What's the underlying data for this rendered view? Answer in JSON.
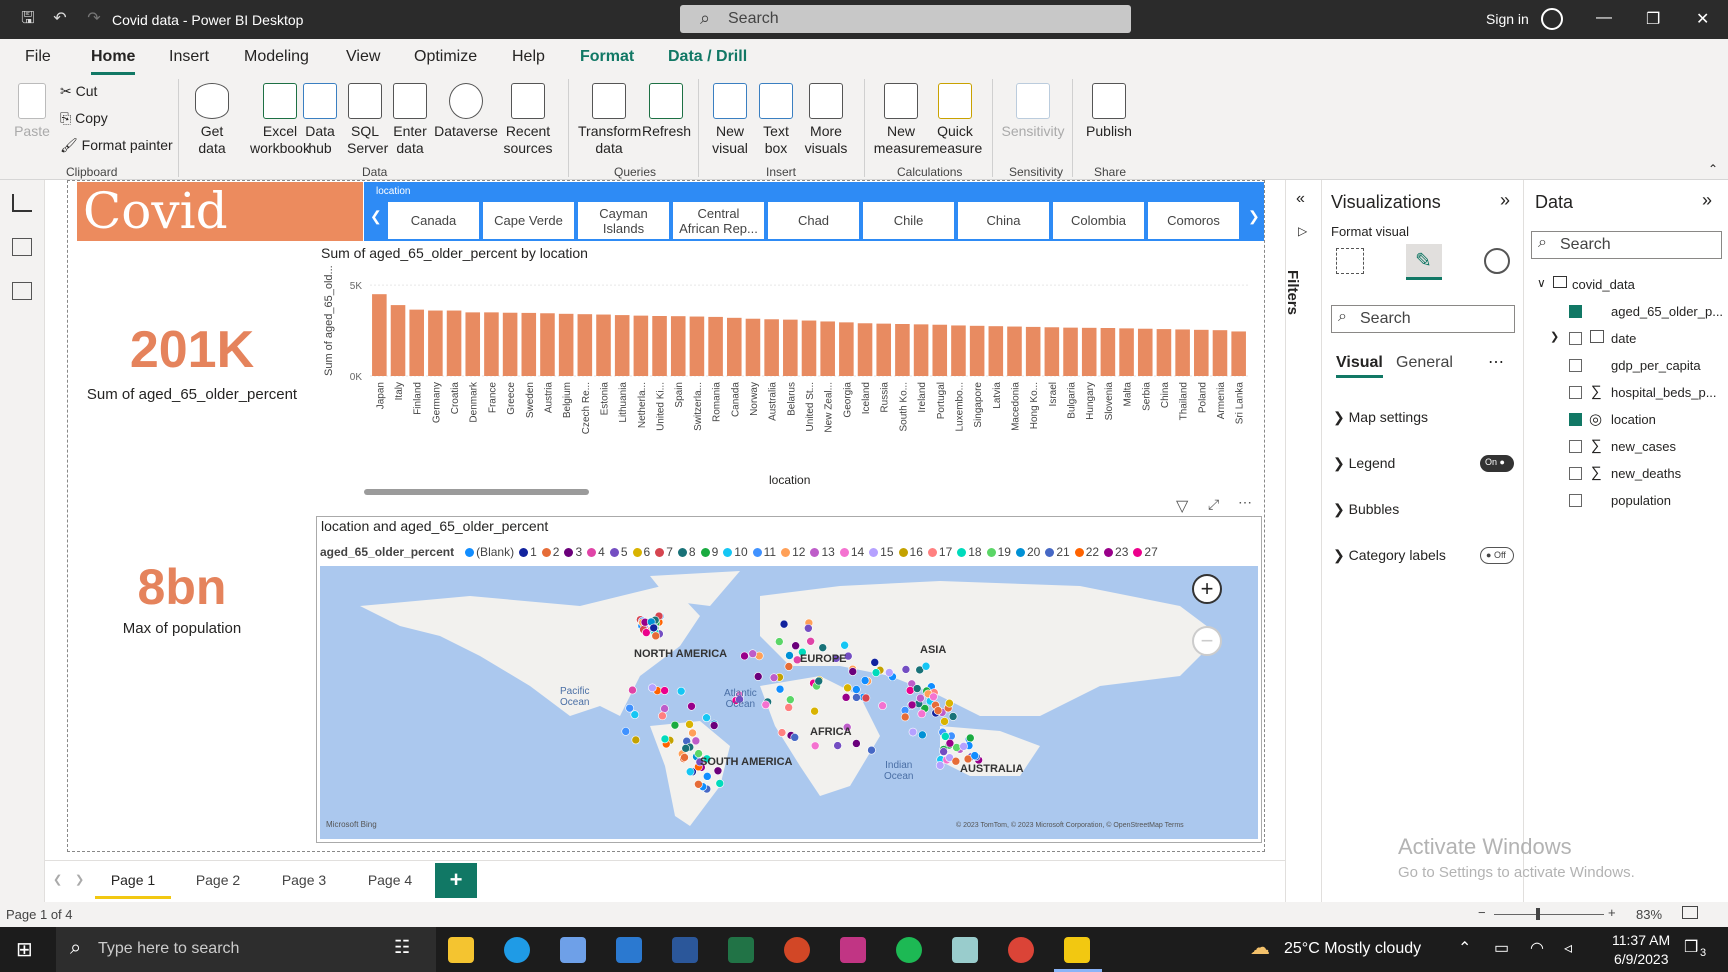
{
  "window": {
    "title": "Covid data - Power BI Desktop",
    "search_placeholder": "Search",
    "signin": "Sign in"
  },
  "menu": {
    "items": [
      "File",
      "Home",
      "Insert",
      "Modeling",
      "View",
      "Optimize",
      "Help",
      "Format",
      "Data / Drill"
    ]
  },
  "ribbon": {
    "clipboard": {
      "paste": "Paste",
      "cut": "Cut",
      "copy": "Copy",
      "format_painter": "Format painter",
      "group": "Clipboard"
    },
    "data": {
      "get_data": "Get\ndata",
      "excel": "Excel\nworkbook",
      "data_hub": "Data\nhub",
      "sql": "SQL\nServer",
      "enter_data": "Enter\ndata",
      "dataverse": "Dataverse",
      "recent": "Recent\nsources",
      "group": "Data"
    },
    "queries": {
      "transform": "Transform\ndata",
      "refresh": "Refresh",
      "group": "Queries"
    },
    "insert": {
      "new_visual": "New\nvisual",
      "text_box": "Text\nbox",
      "more_visuals": "More\nvisuals",
      "group": "Insert"
    },
    "calculations": {
      "new_measure": "New\nmeasure",
      "quick_measure": "Quick\nmeasure",
      "group": "Calculations"
    },
    "sensitivity": {
      "label": "Sensitivity",
      "group": "Sensitivity"
    },
    "share": {
      "publish": "Publish",
      "group": "Share"
    }
  },
  "report": {
    "banner": "Covid Data",
    "slicer": {
      "label": "location",
      "items": [
        "Canada",
        "Cape Verde",
        "Cayman\nIslands",
        "Central\nAfrican Rep...",
        "Chad",
        "Chile",
        "China",
        "Colombia",
        "Comoros"
      ]
    },
    "kpi1": {
      "value": "201K",
      "label": "Sum of aged_65_older_percent"
    },
    "kpi2": {
      "value": "8bn",
      "label": "Max of population"
    },
    "map_title": "location and aged_65_older_percent",
    "map_labels": {
      "na": "NORTH AMERICA",
      "sa": "SOUTH AMERICA",
      "eu": "EUROPE",
      "as": "ASIA",
      "af": "AFRICA",
      "au": "AUSTRALIA",
      "pac": "Pacific\nOcean",
      "atl": "Atlantic\nOcean",
      "ind": "Indian\nOcean",
      "bing": "Microsoft Bing",
      "copy": "© 2023 TomTom, © 2023 Microsoft Corporation, © OpenStreetMap  Terms"
    },
    "map_legend_title": "aged_65_older_percent",
    "map_legend": [
      {
        "name": "(Blank)",
        "color": "#118dff"
      },
      {
        "name": "1",
        "color": "#12239e"
      },
      {
        "name": "2",
        "color": "#e66c37"
      },
      {
        "name": "3",
        "color": "#6b007b"
      },
      {
        "name": "4",
        "color": "#e044a7"
      },
      {
        "name": "5",
        "color": "#744ec2"
      },
      {
        "name": "6",
        "color": "#d9b300"
      },
      {
        "name": "7",
        "color": "#d64550"
      },
      {
        "name": "8",
        "color": "#197278"
      },
      {
        "name": "9",
        "color": "#1aab40"
      },
      {
        "name": "10",
        "color": "#15c6f4"
      },
      {
        "name": "11",
        "color": "#4092ff"
      },
      {
        "name": "12",
        "color": "#ffa058"
      },
      {
        "name": "13",
        "color": "#be5dc9"
      },
      {
        "name": "14",
        "color": "#f472d0"
      },
      {
        "name": "15",
        "color": "#b5a1ff"
      },
      {
        "name": "16",
        "color": "#c4a200"
      },
      {
        "name": "17",
        "color": "#ff8080"
      },
      {
        "name": "18",
        "color": "#00dbbc"
      },
      {
        "name": "19",
        "color": "#5bd667"
      },
      {
        "name": "20",
        "color": "#0091d5"
      },
      {
        "name": "21",
        "color": "#4668c5"
      },
      {
        "name": "22",
        "color": "#ff6300"
      },
      {
        "name": "23",
        "color": "#99008a"
      },
      {
        "name": "27",
        "color": "#ec008c"
      }
    ],
    "pages": [
      "Page 1",
      "Page 2",
      "Page 3",
      "Page 4"
    ],
    "add_page": "+"
  },
  "chart_data": {
    "type": "bar",
    "title": "Sum of aged_65_older_percent by location",
    "xlabel": "location",
    "ylabel": "Sum of aged_65_old...",
    "ytick_labels": [
      "5K",
      "0K"
    ],
    "ylim": [
      0,
      5500
    ],
    "categories": [
      "Japan",
      "Italy",
      "Finland",
      "Germany",
      "Croatia",
      "Denmark",
      "France",
      "Greece",
      "Sweden",
      "Austria",
      "Belgium",
      "Czech Re...",
      "Estonia",
      "Lithuania",
      "Netherla...",
      "United Ki...",
      "Spain",
      "Switzerla...",
      "Romania",
      "Canada",
      "Norway",
      "Australia",
      "Belarus",
      "United St...",
      "New Zeal...",
      "Georgia",
      "Iceland",
      "Russia",
      "South Ko...",
      "Ireland",
      "Portugal",
      "Luxembo...",
      "Singapore",
      "Latvia",
      "Macedonia",
      "Hong Ko...",
      "Israel",
      "Bulgaria",
      "Hungary",
      "Slovenia",
      "Malta",
      "Serbia",
      "China",
      "Thailand",
      "Poland",
      "Armenia",
      "Sri Lanka"
    ],
    "values": [
      4500,
      3900,
      3650,
      3600,
      3600,
      3500,
      3500,
      3480,
      3470,
      3450,
      3420,
      3400,
      3380,
      3350,
      3320,
      3300,
      3290,
      3270,
      3250,
      3200,
      3150,
      3120,
      3100,
      3050,
      3000,
      2950,
      2900,
      2880,
      2860,
      2840,
      2820,
      2780,
      2760,
      2740,
      2720,
      2700,
      2680,
      2660,
      2650,
      2640,
      2620,
      2600,
      2580,
      2560,
      2540,
      2520,
      2450
    ],
    "bar_color": "#e88b61",
    "grid": true
  },
  "visualizations": {
    "title": "Visualizations",
    "format_visual": "Format visual",
    "search": "Search",
    "tab_visual": "Visual",
    "tab_general": "General",
    "sections": [
      {
        "label": "Map settings"
      },
      {
        "label": "Legend",
        "toggle": "On"
      },
      {
        "label": "Bubbles"
      },
      {
        "label": "Category labels",
        "toggle": "Off"
      }
    ]
  },
  "filters": {
    "label": "Filters"
  },
  "data_pane": {
    "title": "Data",
    "search": "Search",
    "table": "covid_data",
    "fields": [
      {
        "name": "aged_65_older_p...",
        "checked": true
      },
      {
        "name": "date",
        "checked": false
      },
      {
        "name": "gdp_per_capita",
        "checked": false
      },
      {
        "name": "hospital_beds_p...",
        "checked": false
      },
      {
        "name": "location",
        "checked": true
      },
      {
        "name": "new_cases",
        "checked": false
      },
      {
        "name": "new_deaths",
        "checked": false
      },
      {
        "name": "population",
        "checked": false
      }
    ]
  },
  "status": {
    "page": "Page 1 of 4",
    "zoom": "83%"
  },
  "activate": {
    "line1": "Activate Windows",
    "line2": "Go to Settings to activate Windows."
  },
  "taskbar": {
    "search": "Type here to search",
    "weather": "25°C  Mostly cloudy",
    "time": "11:37 AM",
    "date": "6/9/2023",
    "notif": "3"
  }
}
